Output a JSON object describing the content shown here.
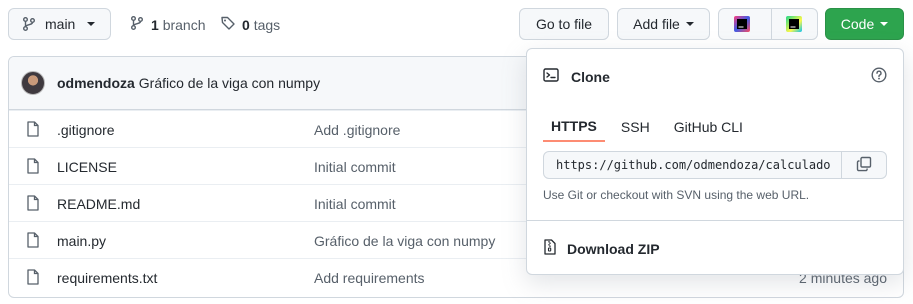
{
  "toolbar": {
    "branch_label": "main",
    "branches_count": "1",
    "branches_label": "branch",
    "tags_count": "0",
    "tags_label": "tags",
    "goto_file": "Go to file",
    "add_file": "Add file",
    "code_label": "Code"
  },
  "commit": {
    "author": "odmendoza",
    "message": "Gráfico de la viga con numpy"
  },
  "files": [
    {
      "name": ".gitignore",
      "message": "Add .gitignore",
      "age": ""
    },
    {
      "name": "LICENSE",
      "message": "Initial commit",
      "age": ""
    },
    {
      "name": "README.md",
      "message": "Initial commit",
      "age": ""
    },
    {
      "name": "main.py",
      "message": "Gráfico de la viga con numpy",
      "age": ""
    },
    {
      "name": "requirements.txt",
      "message": "Add requirements",
      "age": "2 minutes ago"
    }
  ],
  "clone": {
    "title": "Clone",
    "tabs": [
      "HTTPS",
      "SSH",
      "GitHub CLI"
    ],
    "active_tab": "HTTPS",
    "url": "https://github.com/odmendoza/calculado",
    "note": "Use Git or checkout with SVN using the web URL.",
    "download_zip": "Download ZIP"
  },
  "colors": {
    "code_button": "#2da44e",
    "active_tab_underline": "#fd8c73"
  },
  "icons": [
    "branch-icon",
    "git-branch-icon",
    "tag-icon",
    "jetbrains-icon",
    "pycharm-icon",
    "file-icon",
    "terminal-icon",
    "help-icon",
    "copy-icon",
    "zip-icon"
  ]
}
